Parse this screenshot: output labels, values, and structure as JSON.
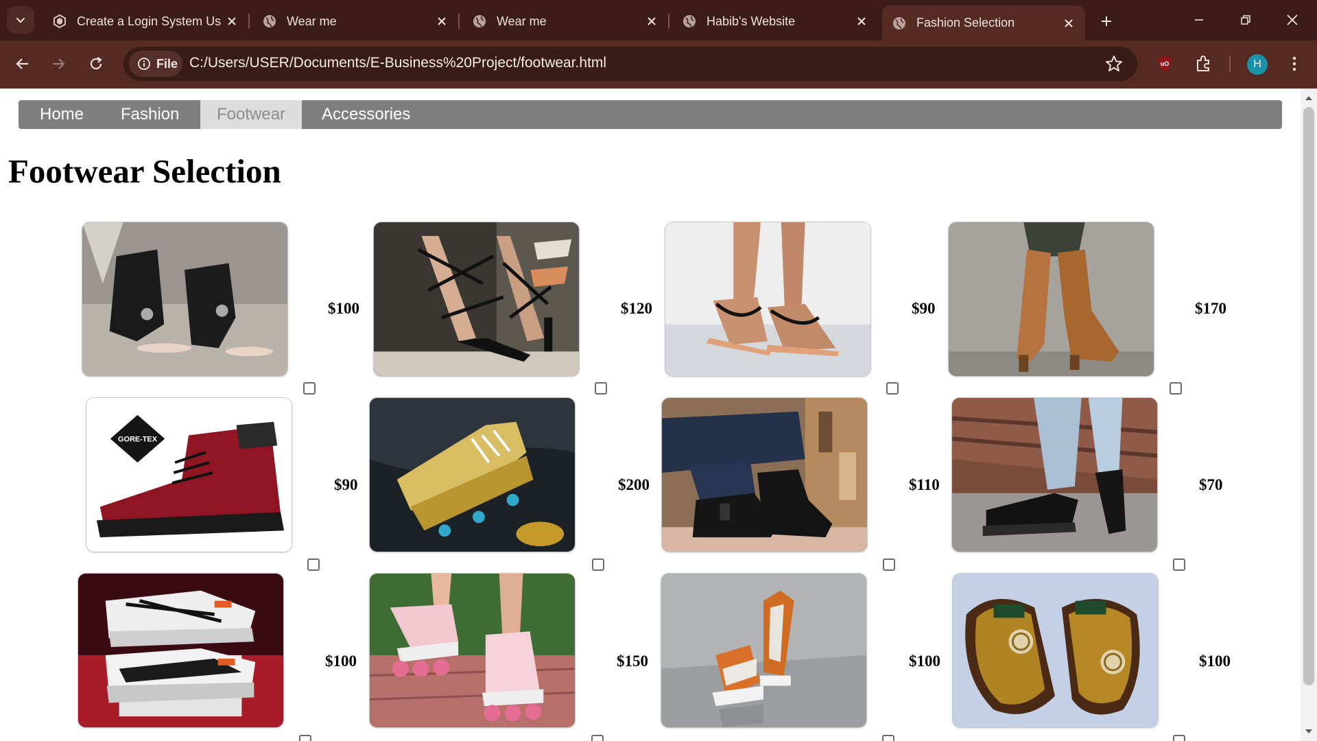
{
  "browser": {
    "tabs": [
      {
        "title": "Create a Login System Us",
        "active": false
      },
      {
        "title": "Wear me",
        "active": false
      },
      {
        "title": "Wear me",
        "active": false
      },
      {
        "title": "Habib's Website",
        "active": false
      },
      {
        "title": "Fashion Selection",
        "active": true
      }
    ],
    "file_chip_label": "File",
    "url": "C:/Users/USER/Documents/E-Business%20Project/footwear.html",
    "profile_initial": "H",
    "extension_badge": "uO"
  },
  "nav": {
    "items": [
      {
        "label": "Home",
        "active": false
      },
      {
        "label": "Fashion",
        "active": false
      },
      {
        "label": "Footwear",
        "active": true
      },
      {
        "label": "Accessories",
        "active": false
      }
    ]
  },
  "page": {
    "title": "Footwear Selection",
    "products": [
      {
        "image": "black-ankle-cuff-sandals",
        "price": "$100",
        "selected": false
      },
      {
        "image": "black-lace-up-heels",
        "price": "$120",
        "selected": false
      },
      {
        "image": "black-thong-sandals",
        "price": "$90",
        "selected": false
      },
      {
        "image": "tan-knee-high-boots",
        "price": "$170",
        "selected": false
      },
      {
        "image": "red-gore-tex-boot",
        "price": "$90",
        "selected": false
      },
      {
        "image": "gold-football-cleats",
        "price": "$200",
        "selected": false
      },
      {
        "image": "black-chelsea-boots",
        "price": "$110",
        "selected": false
      },
      {
        "image": "black-patent-loafers",
        "price": "$70",
        "selected": false
      },
      {
        "image": "white-running-sneakers",
        "price": "$100",
        "selected": false
      },
      {
        "image": "pink-inline-skates",
        "price": "$150",
        "selected": false
      },
      {
        "image": "orange-sneakers",
        "price": "$100",
        "selected": false
      },
      {
        "image": "brown-gold-slides",
        "price": "$100",
        "selected": false
      }
    ],
    "gore_tex_logo": "GORE-TEX"
  },
  "colors": {
    "tabbar": "#3b1c18",
    "toolbar": "#542a23",
    "nav_bg": "#7f7f7f",
    "nav_active_bg": "#dddddd",
    "avatar": "#1a93a8"
  }
}
